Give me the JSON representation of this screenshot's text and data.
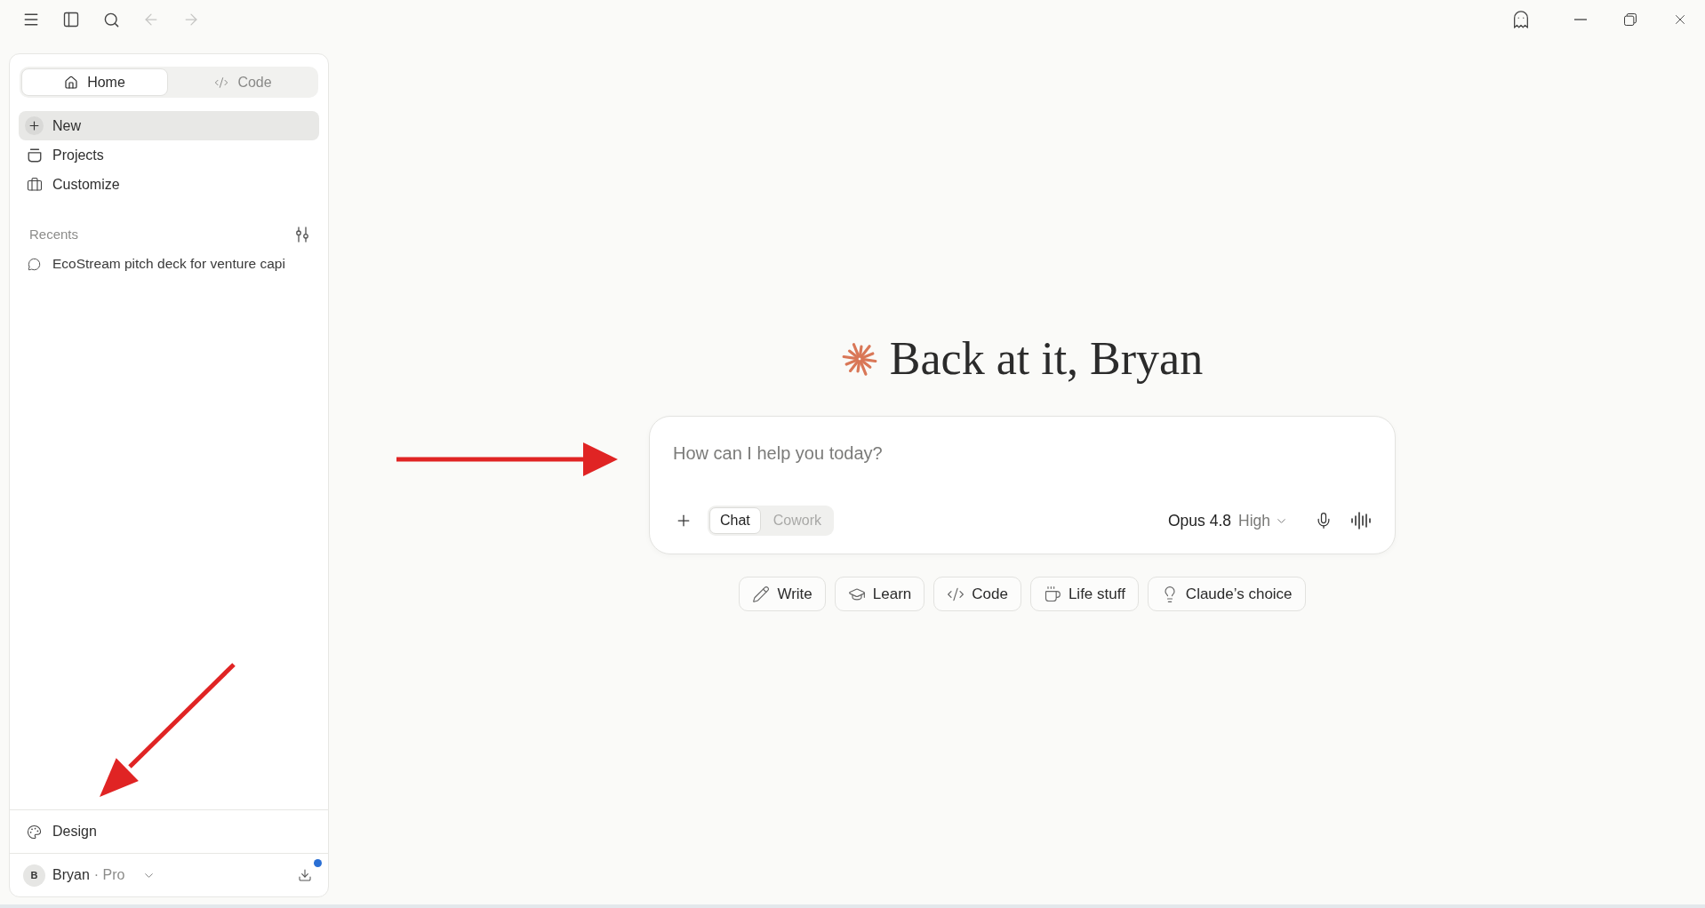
{
  "toolbar": {
    "back": {
      "disabled": true
    },
    "forward": {
      "disabled": true
    }
  },
  "sidebar": {
    "tabs": [
      {
        "label": "Home",
        "selected": true
      },
      {
        "label": "Code",
        "selected": false
      }
    ],
    "nav": [
      {
        "label": "New",
        "selected": true
      },
      {
        "label": "Projects",
        "selected": false
      },
      {
        "label": "Customize",
        "selected": false
      }
    ],
    "recents": {
      "title": "Recents",
      "items": [
        {
          "label": "EcoStream pitch deck for venture capi"
        }
      ]
    },
    "design": {
      "label": "Design"
    },
    "user": {
      "initial": "B",
      "name": "Bryan",
      "plan": "· Pro"
    },
    "download": {
      "notification": true
    }
  },
  "main": {
    "greeting": "Back at it, Bryan",
    "composer": {
      "placeholder": "How can I help you today?",
      "modes": [
        {
          "label": "Chat",
          "selected": true
        },
        {
          "label": "Cowork",
          "selected": false
        }
      ],
      "model": "Opus 4.8",
      "effort": "High"
    },
    "suggestions": [
      "Write",
      "Learn",
      "Code",
      "Life stuff",
      "Claude’s choice"
    ]
  }
}
